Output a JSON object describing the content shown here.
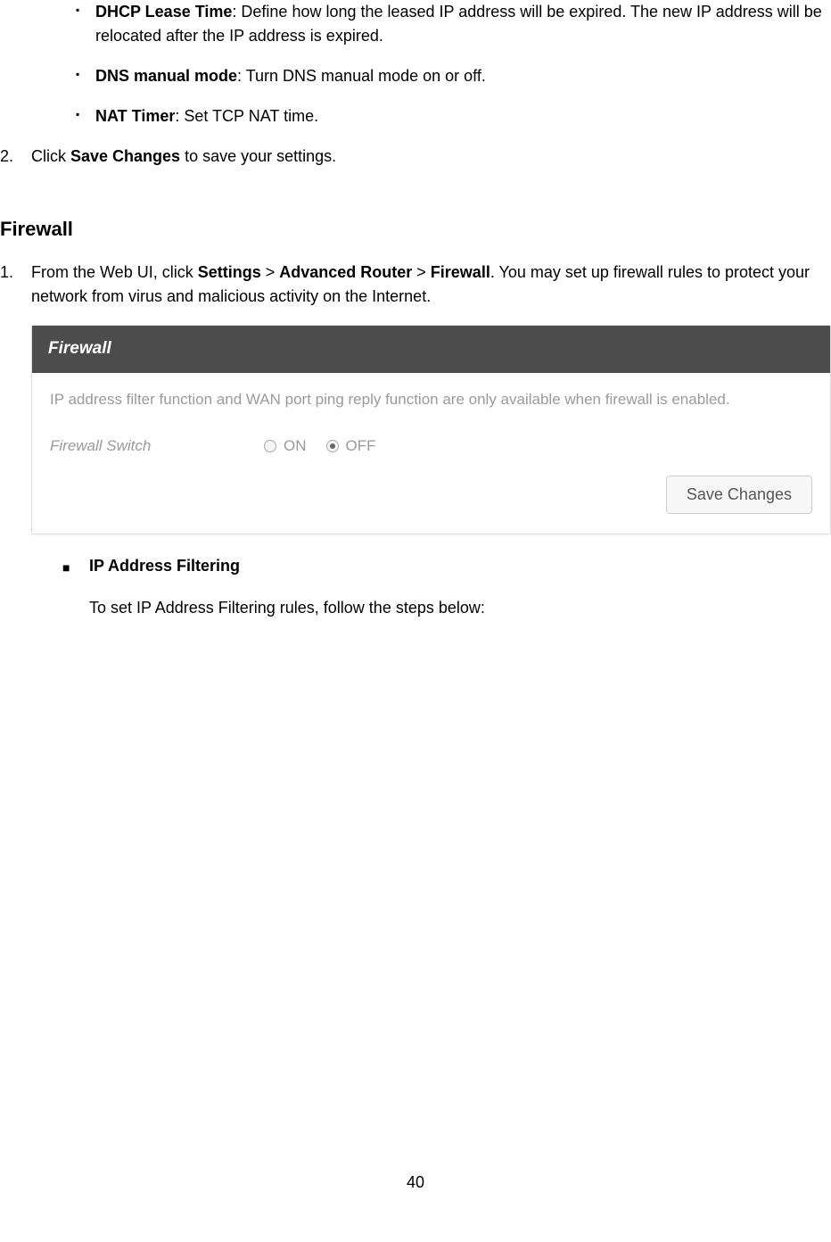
{
  "bullets": {
    "dhcp": {
      "label": "DHCP Lease Time",
      "desc": ": Define how long the leased IP address will be expired. The new IP address will be relocated after the IP address is expired."
    },
    "dns": {
      "label": "DNS manual mode",
      "desc": ": Turn DNS manual mode on or off."
    },
    "nat": {
      "label": "NAT Timer",
      "desc": ": Set TCP NAT time."
    }
  },
  "step2": {
    "marker": "2.",
    "prefix": "Click ",
    "bold": "Save Changes",
    "suffix": " to save your settings."
  },
  "section": {
    "heading": "Firewall"
  },
  "step1": {
    "marker": "1.",
    "prefix": "From the Web UI, click ",
    "b1": "Settings",
    "sep1": " > ",
    "b2": "Advanced Router",
    "sep2": " > ",
    "b3": "Firewall",
    "suffix": ". You may set up firewall rules to protect your network from virus and malicious activity on the Internet."
  },
  "panel": {
    "title": "Firewall",
    "note": "IP address filter function and WAN port ping reply function are only available when firewall is enabled.",
    "switchLabel": "Firewall Switch",
    "onLabel": "ON",
    "offLabel": "OFF",
    "saveButton": "Save Changes"
  },
  "squareBullet": {
    "marker": "■",
    "title": "IP Address Filtering",
    "desc": "To set IP Address Filtering rules, follow the steps below:"
  },
  "pageNumber": "40"
}
